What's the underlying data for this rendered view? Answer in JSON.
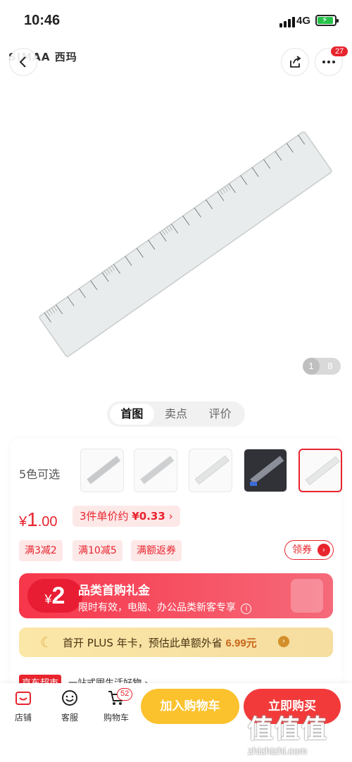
{
  "status": {
    "time": "10:46",
    "network": "4G",
    "battery_color": "#27c14a"
  },
  "header": {
    "brand": "SIMAA 西玛",
    "more_badge": "27"
  },
  "gallery": {
    "current": "1",
    "total": "8"
  },
  "tabs": [
    {
      "label": "首图"
    },
    {
      "label": "卖点"
    },
    {
      "label": "评价"
    }
  ],
  "variants": {
    "label": "5色可选"
  },
  "price": {
    "symbol": "¥",
    "integer": "1",
    "decimal": ".00"
  },
  "unit_price": {
    "prefix": "3件单价约",
    "value": "¥0.33",
    "arrow": "›"
  },
  "promos": [
    {
      "label": "满3减2"
    },
    {
      "label": "满10减5"
    },
    {
      "label": "满额返券"
    }
  ],
  "coupon": {
    "label": "领券",
    "arrow": "›"
  },
  "gift": {
    "currency": "¥",
    "amount": "2",
    "title": "品类首购礼金",
    "desc": "限时有效，电脑、办公品类新客专享",
    "info": "i"
  },
  "plus": {
    "text": "首开 PLUS 年卡，预估此单额外省",
    "amount": "6.99元",
    "arrow": "›"
  },
  "market": {
    "tag": "京东超市",
    "desc": "一站式囤生活好物 ›"
  },
  "bottom": {
    "store": "店铺",
    "service": "客服",
    "cart": "购物车",
    "cart_count": "52",
    "add_cart": "加入购物车",
    "buy_now": "立即购买"
  },
  "watermark": {
    "big": "值值值",
    "small": "zhizhizhi.com"
  },
  "colors": {
    "accent": "#e8242d",
    "cart_button": "#fbc22e",
    "buy_button": "#f23a3a"
  }
}
